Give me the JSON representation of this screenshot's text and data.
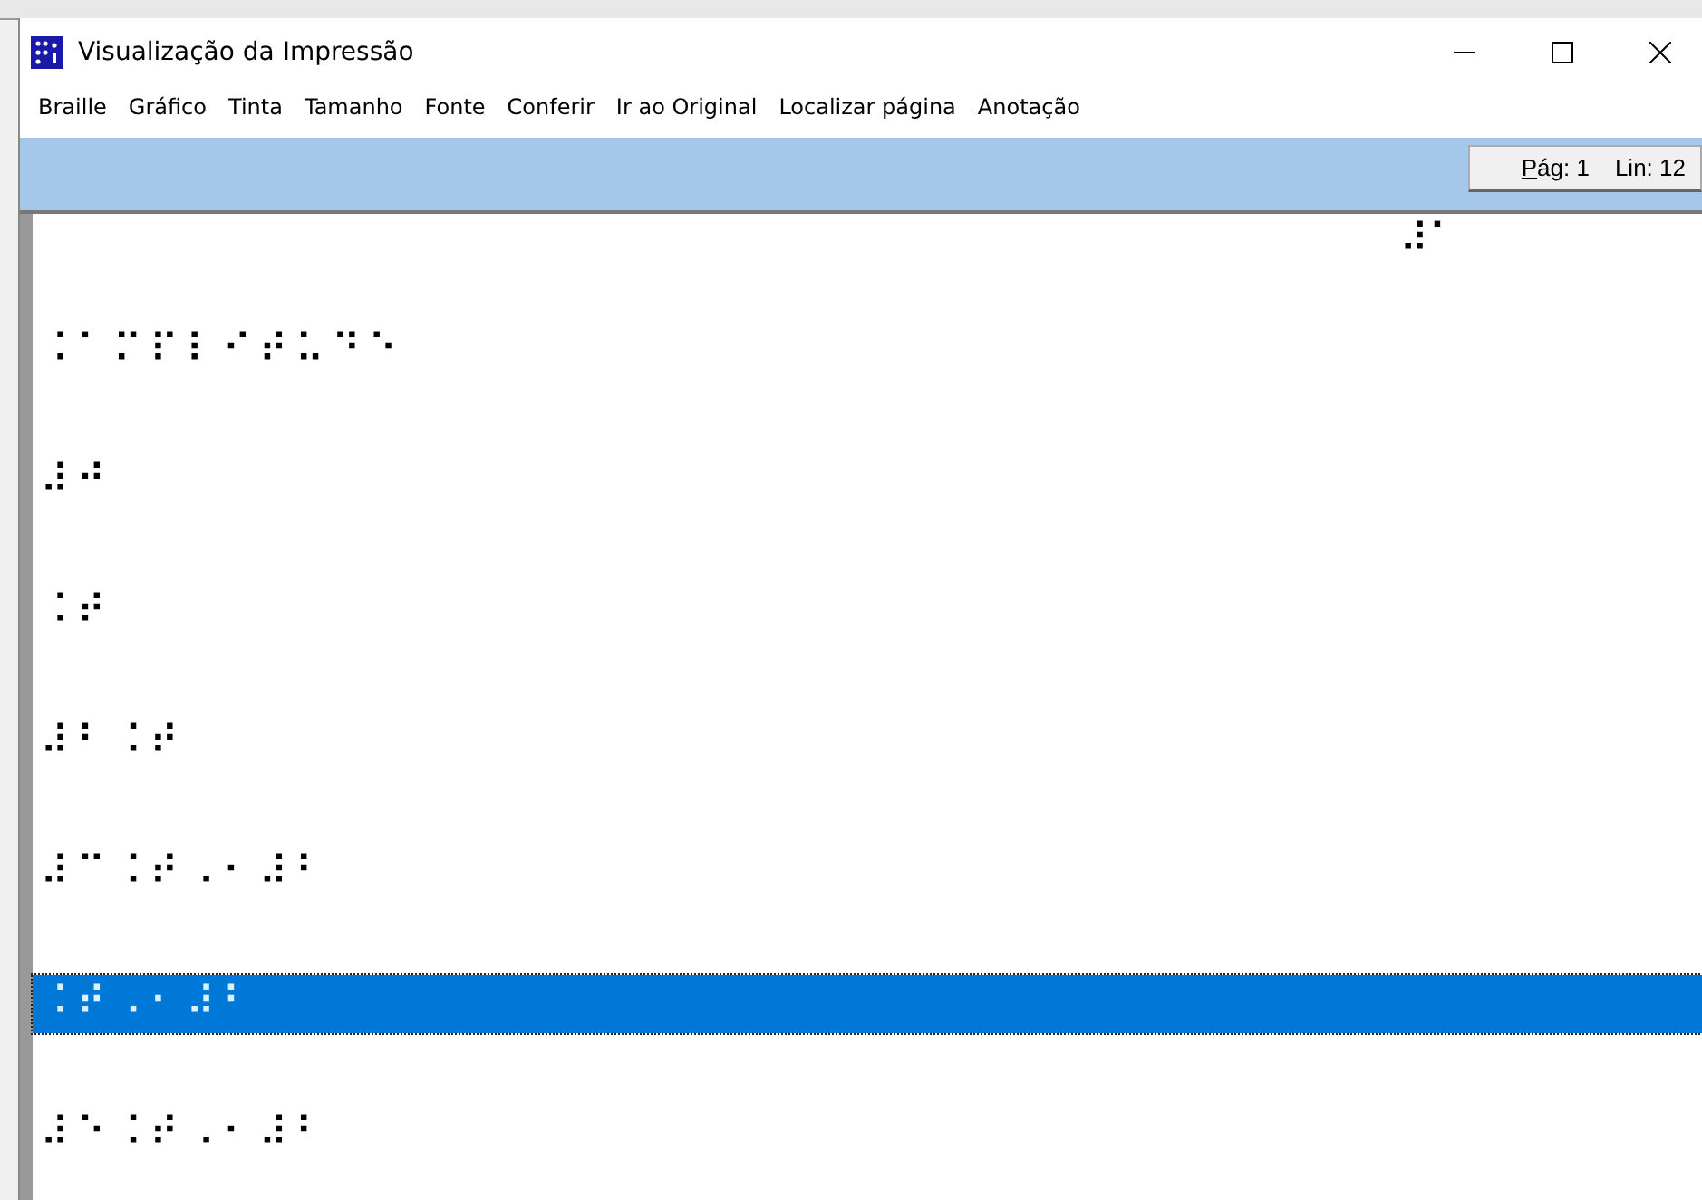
{
  "window": {
    "title": "Visualização da Impressão"
  },
  "menu": [
    "Braille",
    "Gráfico",
    "Tinta",
    "Tamanho",
    "Fonte",
    "Conferir",
    "Ir ao Original",
    "Localizar página",
    "Anotação"
  ],
  "status": {
    "page": "Pág: 1",
    "line": "Lin: 12"
  },
  "page_number": "⠼⠁",
  "lines": [
    {
      "text": "⠨⠁⠍⠏⠇⠊⠞⠥⠙⠑",
      "selected": false
    },
    {
      "text": "⠼⠚",
      "selected": false
    },
    {
      "text": "⠨⠞",
      "selected": false
    },
    {
      "text": "⠼⠃⠨⠞",
      "selected": false
    },
    {
      "text": "⠼⠉⠨⠞⠠⠂⠼⠃",
      "selected": false
    },
    {
      "text": "⠨⠞⠠⠂⠼⠃",
      "selected": true
    },
    {
      "text": "⠼⠑⠨⠞⠠⠂⠼⠃",
      "selected": false
    }
  ]
}
